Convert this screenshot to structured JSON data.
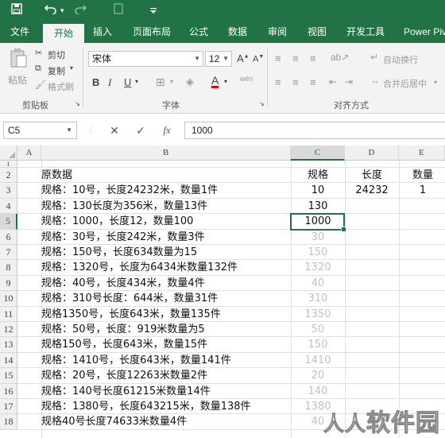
{
  "quick_access": {
    "save_icon": "save-icon",
    "undo_icon": "undo-icon",
    "undo_arrow": "▾",
    "redo_icon": "redo-icon",
    "doc_icon": "document-icon",
    "customize_icon": "customize-qat-icon"
  },
  "tabs": [
    "文件",
    "开始",
    "插入",
    "页面布局",
    "公式",
    "数据",
    "审阅",
    "视图",
    "开发工具",
    "Power Piv"
  ],
  "active_tab": "开始",
  "ribbon": {
    "clipboard": {
      "paste_label": "粘贴",
      "cut_label": "剪切",
      "copy_label": "复制",
      "format_painter_label": "格式刷",
      "group_label": "剪贴板"
    },
    "font": {
      "font_name": "宋体",
      "font_size": "12",
      "bold": "B",
      "italic": "I",
      "underline": "U",
      "font_color_letter": "A",
      "phonetic": "wén",
      "group_label": "字体"
    },
    "alignment": {
      "wrap_text_label": "自动换行",
      "merge_center_label": "合并后居中",
      "group_label": "对齐方式"
    }
  },
  "formula_bar": {
    "name_box": "C5",
    "cancel_icon": "cancel-icon",
    "enter_icon": "check-icon",
    "fx_label": "fx",
    "value": "1000"
  },
  "sheet": {
    "columns": [
      "A",
      "B",
      "C",
      "D",
      "E"
    ],
    "selected_column": "C",
    "selected_row": "5",
    "row_numbers": [
      "1",
      "2",
      "3",
      "4",
      "5",
      "6",
      "7",
      "8",
      "9",
      "10",
      "11",
      "12",
      "13",
      "14",
      "15",
      "16",
      "17",
      "18"
    ],
    "rows": [
      {
        "b": "",
        "c": "",
        "d": "",
        "e": ""
      },
      {
        "b": "原数据",
        "c": "规格",
        "d": "长度",
        "e": "数量"
      },
      {
        "b": "规格：10号，长度24232米，数量1件",
        "c": "10",
        "d": "24232",
        "e": "1"
      },
      {
        "b": "规格：130长度为356米，数量13件",
        "c": "130",
        "d": "",
        "e": ""
      },
      {
        "b": "规格：1000，长度12，数量100",
        "c": "1000",
        "d": "",
        "e": ""
      },
      {
        "b": "规格：30号，长度242米，数量3件",
        "c": "30",
        "d": "",
        "e": ""
      },
      {
        "b": "规格：150号，长度634数量为15",
        "c": "150",
        "d": "",
        "e": ""
      },
      {
        "b": "规格：1320号，长度为6434米数量132件",
        "c": "1320",
        "d": "",
        "e": ""
      },
      {
        "b": "规格：40号，长度434米，数量4件",
        "c": "40",
        "d": "",
        "e": ""
      },
      {
        "b": "规格：310号长度：644米，数量31件",
        "c": "310",
        "d": "",
        "e": ""
      },
      {
        "b": "规格1350号，长度643米，数量135件",
        "c": "1350",
        "d": "",
        "e": ""
      },
      {
        "b": "规格：50号，长度：919米数量为5",
        "c": "50",
        "d": "",
        "e": ""
      },
      {
        "b": "规格150号，长度643米，数量15件",
        "c": "150",
        "d": "",
        "e": ""
      },
      {
        "b": "规格：1410号，长度643米，数量141件",
        "c": "1410",
        "d": "",
        "e": ""
      },
      {
        "b": "规格：20号，长度12263米数量2件",
        "c": "20",
        "d": "",
        "e": ""
      },
      {
        "b": "规格：140号长度61215米数量14件",
        "c": "140",
        "d": "",
        "e": ""
      },
      {
        "b": "规格：1380号，长度643215米，数量138件",
        "c": "1380",
        "d": "",
        "e": ""
      },
      {
        "b": "规格40号长度74633米数量4件",
        "c": "40",
        "d": "",
        "e": ""
      }
    ]
  },
  "watermark": "软件园",
  "colors": {
    "accent": "#217346",
    "ribbon_bg": "#f3f3f3",
    "flash_fill_preview": "#c2c2c2"
  }
}
